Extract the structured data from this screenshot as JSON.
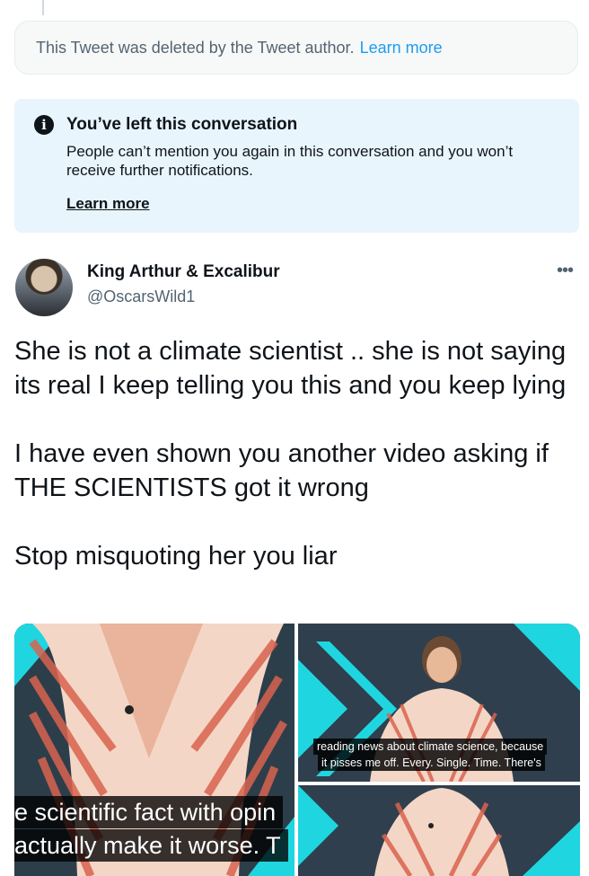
{
  "deleted_notice": {
    "text": "This Tweet was deleted by the Tweet author.",
    "link": "Learn more"
  },
  "left_conversation": {
    "icon": "info-icon",
    "title": "You’ve left this conversation",
    "description": "People can’t mention you again in this conversation and you won’t receive further notifications.",
    "link": "Learn more"
  },
  "tweet": {
    "author_name": "King Arthur & Excalibur",
    "author_handle": "@OscarsWild1",
    "more_icon": "ellipsis-icon",
    "paragraphs": [
      "She is not a climate scientist .. she is not saying its real I keep telling you this and you keep lying",
      "I have even shown you another video asking if THE SCIENTISTS got it wrong",
      "Stop misquoting her you liar"
    ],
    "media": {
      "left_caption_line1": "e scientific fact with opin",
      "left_caption_line2": "actually make it worse. T",
      "right_caption_line1": "reading news about climate science, because",
      "right_caption_line2": "it pisses me off. Every. Single. Time. There's"
    }
  },
  "colors": {
    "link_blue": "#1d9bf0",
    "notice_bg": "#e8f5fd",
    "secondary_text": "#536471",
    "video_cyan": "#1fd6e0"
  }
}
